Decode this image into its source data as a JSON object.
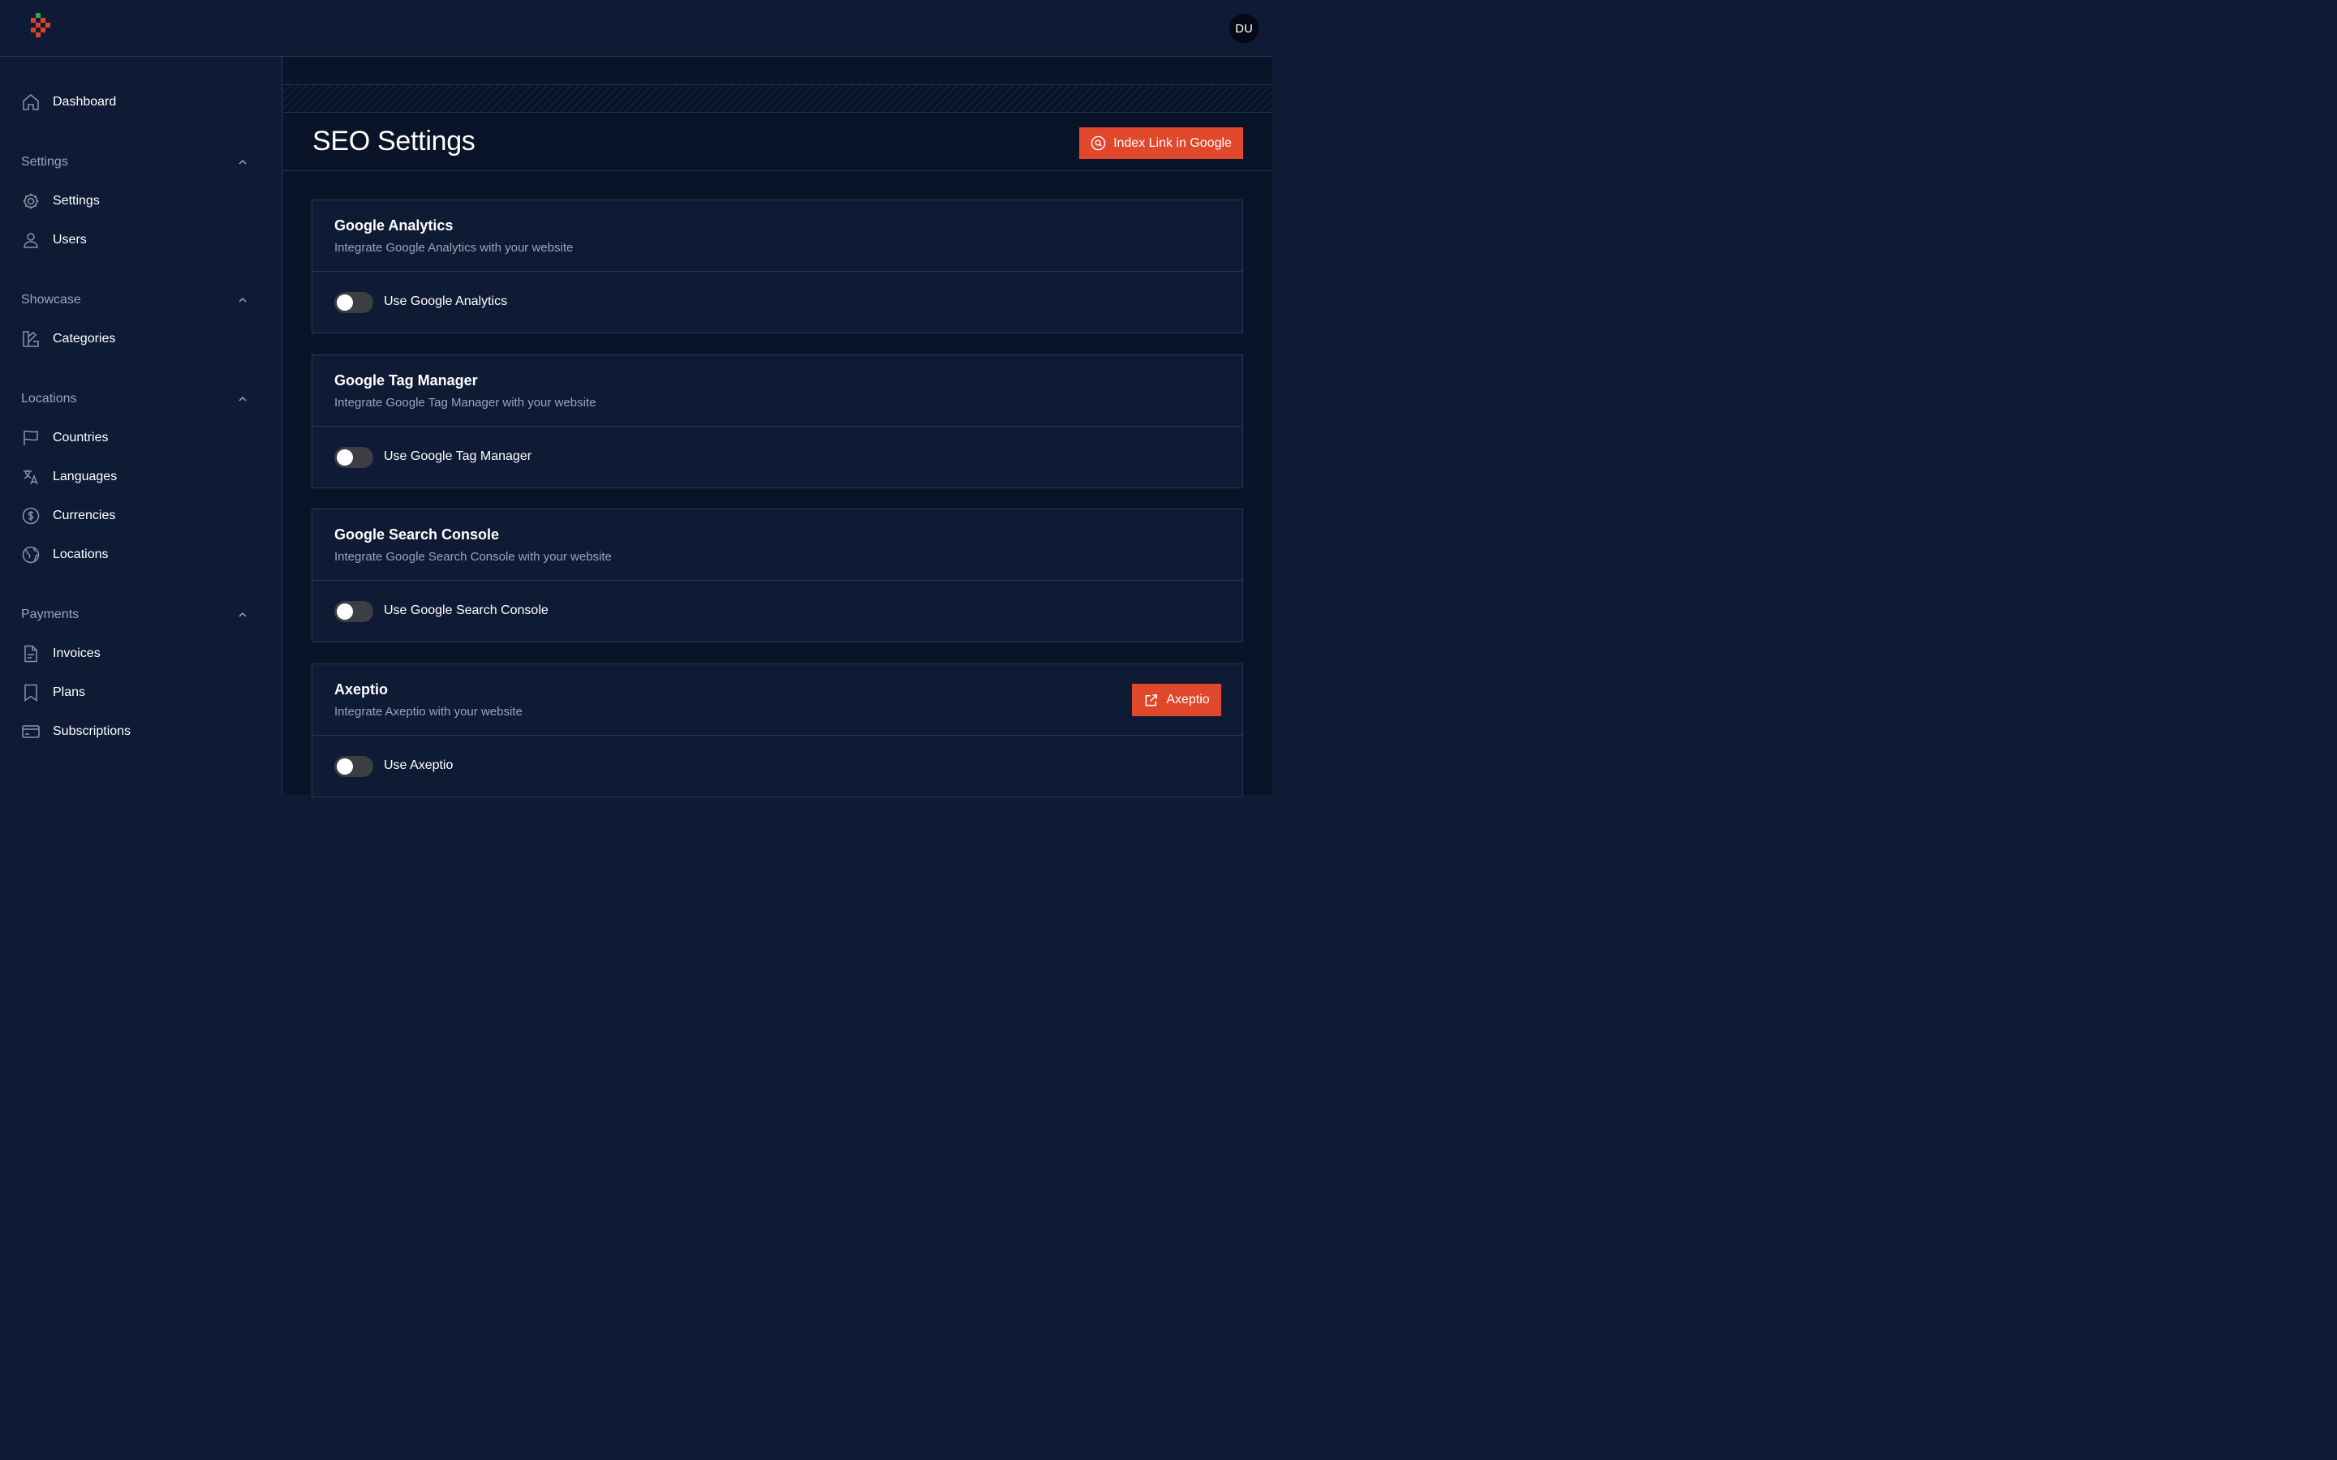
{
  "user": {
    "initials": "DU"
  },
  "sidebar": {
    "dashboard": "Dashboard",
    "groups": [
      {
        "label": "Settings",
        "items": [
          "Settings",
          "Users"
        ]
      },
      {
        "label": "Showcase",
        "items": [
          "Categories"
        ]
      },
      {
        "label": "Locations",
        "items": [
          "Countries",
          "Languages",
          "Currencies",
          "Locations"
        ]
      },
      {
        "label": "Payments",
        "items": [
          "Invoices",
          "Plans",
          "Subscriptions"
        ]
      }
    ]
  },
  "page": {
    "title": "SEO Settings",
    "index_button": "Index Link in Google"
  },
  "cards": [
    {
      "title": "Google Analytics",
      "subtitle": "Integrate Google Analytics with your website",
      "toggle_label": "Use Google Analytics",
      "enabled": false
    },
    {
      "title": "Google Tag Manager",
      "subtitle": "Integrate Google Tag Manager with your website",
      "toggle_label": "Use Google Tag Manager",
      "enabled": false
    },
    {
      "title": "Google Search Console",
      "subtitle": "Integrate Google Search Console with your website",
      "toggle_label": "Use Google Search Console",
      "enabled": false
    },
    {
      "title": "Axeptio",
      "subtitle": "Integrate Axeptio with your website",
      "toggle_label": "Use Axeptio",
      "enabled": false,
      "button_label": "Axeptio"
    }
  ],
  "colors": {
    "accent": "#e1472a",
    "background": "#0f1b35",
    "content_bg": "#0a1428",
    "muted_text": "#9aa4b8"
  },
  "icons": [
    "home-icon",
    "gear-icon",
    "user-icon",
    "categories-icon",
    "flag-icon",
    "translate-icon",
    "dollar-circle-icon",
    "globe-icon",
    "document-icon",
    "bookmark-icon",
    "credit-card-icon",
    "chevron-up-icon",
    "search-circle-icon",
    "external-link-icon"
  ]
}
